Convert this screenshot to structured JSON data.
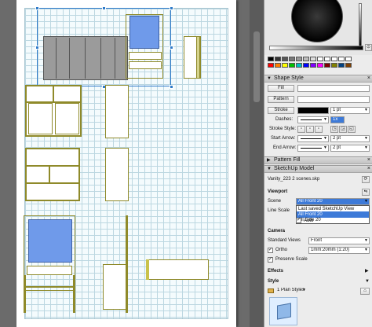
{
  "panel": {
    "color_wheel": {
      "label": "color-wheel"
    },
    "palette_colors": [
      "#000000",
      "#333333",
      "#555555",
      "#777777",
      "#999999",
      "#bbbbbb",
      "#dddddd",
      "#ffffff",
      "#ffffff",
      "#ffffff",
      "#ff0000",
      "#ff8000",
      "#ffff00",
      "#00c000",
      "#00c0c0",
      "#0000ff",
      "#8000ff",
      "#ff00ff",
      "#800000",
      "#808000",
      "#004000",
      "#004080",
      "#400080",
      "#804000"
    ],
    "shape_style": {
      "title": "Shape Style",
      "fill_label": "Fill",
      "pattern_label": "Pattern",
      "stroke_label": "Stroke",
      "stroke_weight": "1 pt",
      "dashes_label": "Dashes:",
      "dash_scale": "1x",
      "stroke_style_label": "Stroke Style:",
      "start_arrow_label": "Start Arrow:",
      "start_arrow_size": "2 pt",
      "end_arrow_label": "End Arrow:",
      "end_arrow_size": "2 pt"
    },
    "pattern_fill": {
      "title": "Pattern Fill"
    },
    "sketchup_model": {
      "title": "SketchUp Model",
      "file_name": "Vanity_223 2 scenes.skp",
      "viewport_label": "Viewport",
      "scene_label": "Scene",
      "scene_value": "All Front 20",
      "scene_options": [
        "Last saved SketchUp View",
        "All Front 20",
        "All Side 20"
      ],
      "line_scale_label": "Line Scale",
      "auto_label": "Auto",
      "camera_label": "Camera",
      "standard_views_label": "Standard Views",
      "standard_views_value": "Front",
      "ortho_label": "Ortho",
      "ortho_value": "1mm:20mm (1:20)",
      "preserve_scale_label": "Preserve Scale",
      "effects_label": "Effects",
      "style_label": "Style",
      "style_value": "1 Plan Styles"
    }
  }
}
